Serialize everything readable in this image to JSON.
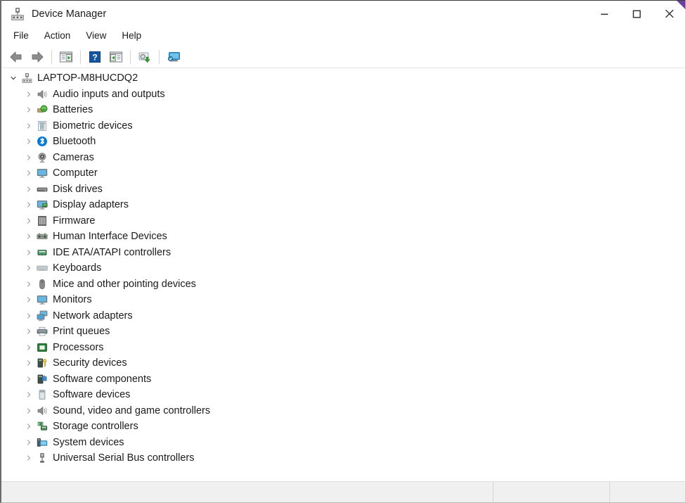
{
  "window": {
    "title": "Device Manager",
    "app_icon": "device-manager-icon",
    "controls": {
      "minimize": "Minimize",
      "maximize": "Maximize",
      "close": "Close"
    }
  },
  "menubar": {
    "items": [
      {
        "label": "File"
      },
      {
        "label": "Action"
      },
      {
        "label": "View"
      },
      {
        "label": "Help"
      }
    ]
  },
  "toolbar": {
    "buttons": [
      {
        "name": "back-button",
        "icon": "back-arrow-icon",
        "tooltip": "Back"
      },
      {
        "name": "forward-button",
        "icon": "forward-arrow-icon",
        "tooltip": "Forward"
      },
      {
        "name": "show-hide-console-tree-button",
        "icon": "console-tree-icon",
        "tooltip": "Show/Hide Console Tree"
      },
      {
        "name": "help-button",
        "icon": "help-question-icon",
        "tooltip": "Help"
      },
      {
        "name": "properties-button",
        "icon": "properties-icon",
        "tooltip": "Properties"
      },
      {
        "name": "update-driver-button",
        "icon": "update-driver-icon",
        "tooltip": "Update Driver Software"
      },
      {
        "name": "scan-hardware-changes-button",
        "icon": "scan-hardware-icon",
        "tooltip": "Scan for hardware changes"
      }
    ]
  },
  "tree": {
    "root": {
      "label": "LAPTOP-M8HUCDQ2",
      "icon": "computer-node-icon",
      "expanded": true
    },
    "items": [
      {
        "label": "Audio inputs and outputs",
        "icon": "speaker-icon",
        "expanded": false
      },
      {
        "label": "Batteries",
        "icon": "battery-icon",
        "expanded": false
      },
      {
        "label": "Biometric devices",
        "icon": "biometric-icon",
        "expanded": false
      },
      {
        "label": "Bluetooth",
        "icon": "bluetooth-icon",
        "expanded": false
      },
      {
        "label": "Cameras",
        "icon": "camera-icon",
        "expanded": false
      },
      {
        "label": "Computer",
        "icon": "monitor-icon",
        "expanded": false
      },
      {
        "label": "Disk drives",
        "icon": "disk-drive-icon",
        "expanded": false
      },
      {
        "label": "Display adapters",
        "icon": "display-adapter-icon",
        "expanded": false
      },
      {
        "label": "Firmware",
        "icon": "firmware-icon",
        "expanded": false
      },
      {
        "label": "Human Interface Devices",
        "icon": "hid-icon",
        "expanded": false
      },
      {
        "label": "IDE ATA/ATAPI controllers",
        "icon": "ide-controller-icon",
        "expanded": false
      },
      {
        "label": "Keyboards",
        "icon": "keyboard-icon",
        "expanded": false
      },
      {
        "label": "Mice and other pointing devices",
        "icon": "mouse-icon",
        "expanded": false
      },
      {
        "label": "Monitors",
        "icon": "monitor-icon",
        "expanded": false
      },
      {
        "label": "Network adapters",
        "icon": "network-adapter-icon",
        "expanded": false
      },
      {
        "label": "Print queues",
        "icon": "printer-icon",
        "expanded": false
      },
      {
        "label": "Processors",
        "icon": "processor-icon",
        "expanded": false
      },
      {
        "label": "Security devices",
        "icon": "security-key-icon",
        "expanded": false
      },
      {
        "label": "Software components",
        "icon": "software-component-icon",
        "expanded": false
      },
      {
        "label": "Software devices",
        "icon": "software-device-icon",
        "expanded": false
      },
      {
        "label": "Sound, video and game controllers",
        "icon": "speaker-icon",
        "expanded": false
      },
      {
        "label": "Storage controllers",
        "icon": "storage-controller-icon",
        "expanded": false
      },
      {
        "label": "System devices",
        "icon": "system-device-icon",
        "expanded": false
      },
      {
        "label": "Universal Serial Bus controllers",
        "icon": "usb-icon",
        "expanded": false
      }
    ]
  },
  "statusbar": {
    "panes": [
      {
        "text": ""
      },
      {
        "text": ""
      },
      {
        "text": ""
      }
    ]
  },
  "colors": {
    "accent_corner": "#6b3fa0",
    "text": "#1b1b1b",
    "statusbar_bg": "#f0f0f0",
    "bluetooth": "#0a7bd4",
    "processor_green": "#1e7a32",
    "help_blue": "#1456a0"
  }
}
